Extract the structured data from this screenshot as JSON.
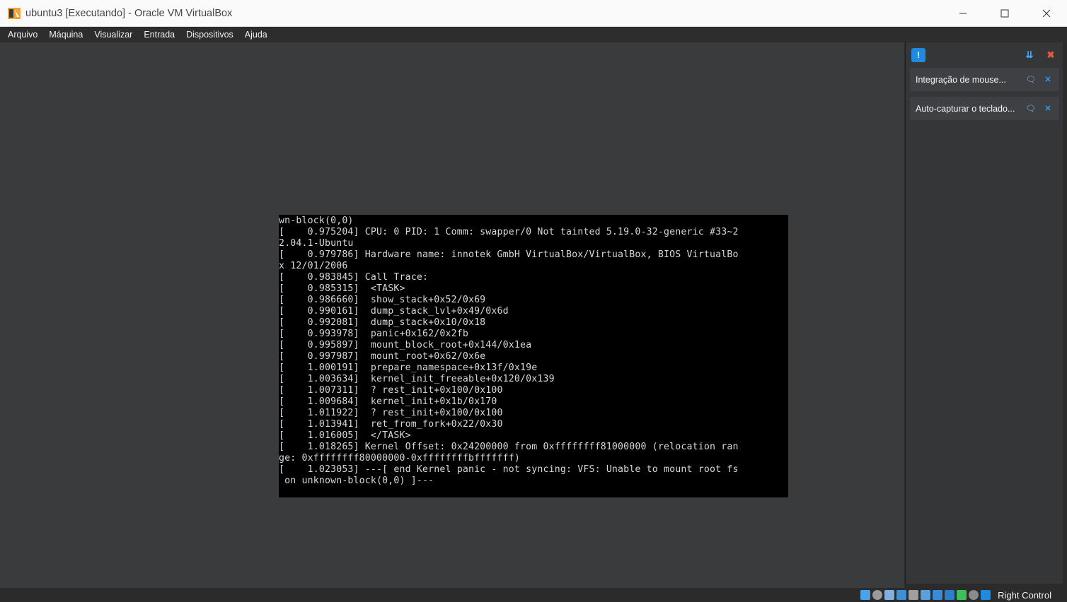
{
  "window": {
    "title": "ubuntu3 [Executando] - Oracle VM VirtualBox",
    "app_icon": "virtualbox-icon",
    "controls": [
      "minimize-icon",
      "maximize-icon",
      "close-icon"
    ]
  },
  "menu": {
    "items": [
      {
        "label": "Arquivo"
      },
      {
        "label": "Máquina"
      },
      {
        "label": "Visualizar"
      },
      {
        "label": "Entrada"
      },
      {
        "label": "Dispositivos"
      },
      {
        "label": "Ajuda"
      }
    ]
  },
  "console": {
    "lines": [
      "wn-block(0,0)",
      "[    0.975204] CPU: 0 PID: 1 Comm: swapper/0 Not tainted 5.19.0-32-generic #33~2",
      "2.04.1-Ubuntu",
      "[    0.979786] Hardware name: innotek GmbH VirtualBox/VirtualBox, BIOS VirtualBo",
      "x 12/01/2006",
      "[    0.983845] Call Trace:",
      "[    0.985315]  <TASK>",
      "[    0.986660]  show_stack+0x52/0x69",
      "[    0.990161]  dump_stack_lvl+0x49/0x6d",
      "[    0.992081]  dump_stack+0x10/0x18",
      "[    0.993978]  panic+0x162/0x2fb",
      "[    0.995897]  mount_block_root+0x144/0x1ea",
      "[    0.997987]  mount_root+0x62/0x6e",
      "[    1.000191]  prepare_namespace+0x13f/0x19e",
      "[    1.003634]  kernel_init_freeable+0x120/0x139",
      "[    1.007311]  ? rest_init+0x100/0x100",
      "[    1.009684]  kernel_init+0x1b/0x170",
      "[    1.011922]  ? rest_init+0x100/0x100",
      "[    1.013941]  ret_from_fork+0x22/0x30",
      "[    1.016005]  </TASK>",
      "[    1.018265] Kernel Offset: 0x24200000 from 0xffffffff81000000 (relocation ran",
      "ge: 0xffffffff80000000-0xffffffffbfffffff)",
      "[    1.023053] ---[ end Kernel panic - not syncing: VFS: Unable to mount root fs",
      " on unknown-block(0,0) ]---"
    ]
  },
  "notifications": {
    "top_icons": [
      "notification-center-icon",
      "sort-icon",
      "clear-all-icon"
    ],
    "items": [
      {
        "text": "Integração de mouse..."
      },
      {
        "text": "Auto-capturar o teclado..."
      }
    ]
  },
  "statusbar": {
    "icons": [
      "hard-disk-icon",
      "optical-drive-icon",
      "audio-icon",
      "network-icon",
      "usb-icon",
      "shared-folders-icon",
      "display-icon",
      "recording-icon",
      "cpu-icon",
      "mouse-integration-icon",
      "keyboard-icon"
    ],
    "host_key": "Right Control"
  },
  "colors": {
    "accent": "#1e8be0",
    "notif_close": "#2aa0ff"
  }
}
